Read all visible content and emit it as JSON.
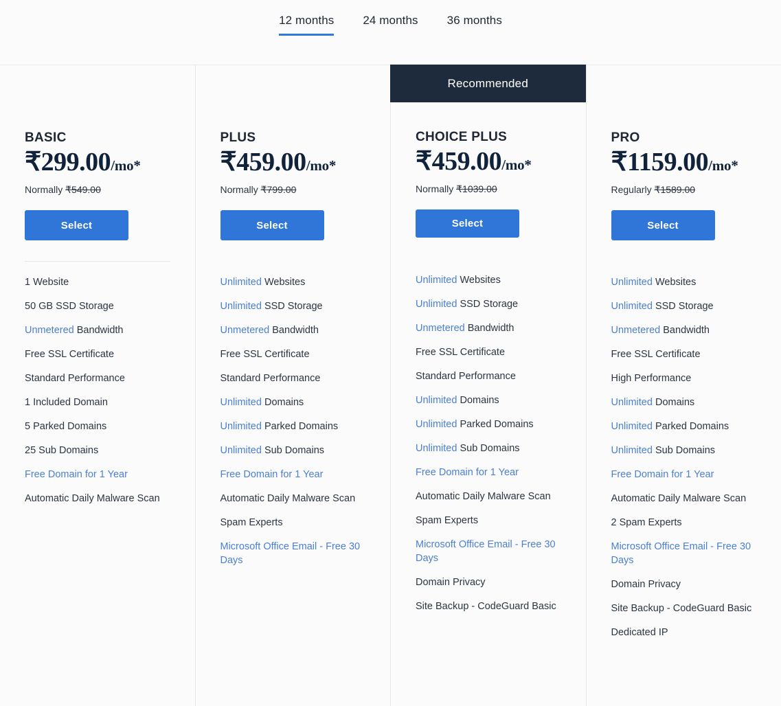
{
  "terms": {
    "tabs": [
      {
        "label": "12 months",
        "active": true
      },
      {
        "label": "24 months",
        "active": false
      },
      {
        "label": "36 months",
        "active": false
      }
    ]
  },
  "colors": {
    "accent_blue": "#2f76d8",
    "link_blue": "#4a7fd4",
    "ribbon_navy": "#1e2b3c",
    "page_bg": "#fbfbfb",
    "text": "#2b3441"
  },
  "ribbon_label": "Recommended",
  "plans": [
    {
      "name": "BASIC",
      "price_amount": "₹299.00",
      "price_period": "/mo*",
      "normally_label": "Normally",
      "normally_price": "₹549.00",
      "select_label": "Select",
      "recommended": false,
      "features": [
        {
          "highlight": "",
          "rest": "1 Website"
        },
        {
          "highlight": "",
          "rest": "50 GB SSD Storage"
        },
        {
          "highlight": "Unmetered",
          "rest": " Bandwidth"
        },
        {
          "highlight": "",
          "rest": "Free SSL Certificate"
        },
        {
          "highlight": "",
          "rest": "Standard Performance"
        },
        {
          "highlight": "",
          "rest": "1 Included Domain"
        },
        {
          "highlight": "",
          "rest": "5 Parked Domains"
        },
        {
          "highlight": "",
          "rest": "25 Sub Domains"
        },
        {
          "highlight": "Free Domain for 1 Year",
          "rest": ""
        },
        {
          "highlight": "",
          "rest": "Automatic Daily Malware Scan"
        }
      ]
    },
    {
      "name": "PLUS",
      "price_amount": "₹459.00",
      "price_period": "/mo*",
      "normally_label": "Normally",
      "normally_price": "₹799.00",
      "select_label": "Select",
      "recommended": false,
      "features": [
        {
          "highlight": "Unlimited",
          "rest": " Websites"
        },
        {
          "highlight": "Unlimited",
          "rest": " SSD Storage"
        },
        {
          "highlight": "Unmetered",
          "rest": " Bandwidth"
        },
        {
          "highlight": "",
          "rest": "Free SSL Certificate"
        },
        {
          "highlight": "",
          "rest": "Standard Performance"
        },
        {
          "highlight": "Unlimited",
          "rest": " Domains"
        },
        {
          "highlight": "Unlimited",
          "rest": " Parked Domains"
        },
        {
          "highlight": "Unlimited",
          "rest": " Sub Domains"
        },
        {
          "highlight": "Free Domain for 1 Year",
          "rest": ""
        },
        {
          "highlight": "",
          "rest": "Automatic Daily Malware Scan"
        },
        {
          "highlight": "",
          "rest": "Spam Experts"
        },
        {
          "highlight": "Microsoft Office Email - Free 30 Days",
          "rest": ""
        }
      ]
    },
    {
      "name": "CHOICE PLUS",
      "price_amount": "₹459.00",
      "price_period": "/mo*",
      "normally_label": "Normally",
      "normally_price": "₹1039.00",
      "select_label": "Select",
      "recommended": true,
      "features": [
        {
          "highlight": "Unlimited",
          "rest": " Websites"
        },
        {
          "highlight": "Unlimited",
          "rest": " SSD Storage"
        },
        {
          "highlight": "Unmetered",
          "rest": " Bandwidth"
        },
        {
          "highlight": "",
          "rest": "Free SSL Certificate"
        },
        {
          "highlight": "",
          "rest": "Standard Performance"
        },
        {
          "highlight": "Unlimited",
          "rest": " Domains"
        },
        {
          "highlight": "Unlimited",
          "rest": " Parked Domains"
        },
        {
          "highlight": "Unlimited",
          "rest": " Sub Domains"
        },
        {
          "highlight": "Free Domain for 1 Year",
          "rest": ""
        },
        {
          "highlight": "",
          "rest": "Automatic Daily Malware Scan"
        },
        {
          "highlight": "",
          "rest": "Spam Experts"
        },
        {
          "highlight": "Microsoft Office Email - Free 30 Days",
          "rest": ""
        },
        {
          "highlight": "",
          "rest": "Domain Privacy"
        },
        {
          "highlight": "",
          "rest": "Site Backup - CodeGuard Basic"
        }
      ]
    },
    {
      "name": "PRO",
      "price_amount": "₹1159.00",
      "price_period": "/mo*",
      "normally_label": "Regularly",
      "normally_price": "₹1589.00",
      "select_label": "Select",
      "recommended": false,
      "features": [
        {
          "highlight": "Unlimited",
          "rest": " Websites"
        },
        {
          "highlight": "Unlimited",
          "rest": " SSD Storage"
        },
        {
          "highlight": "Unmetered",
          "rest": " Bandwidth"
        },
        {
          "highlight": "",
          "rest": "Free SSL Certificate"
        },
        {
          "highlight": "",
          "rest": "High Performance"
        },
        {
          "highlight": "Unlimited",
          "rest": " Domains"
        },
        {
          "highlight": "Unlimited",
          "rest": " Parked Domains"
        },
        {
          "highlight": "Unlimited",
          "rest": " Sub Domains"
        },
        {
          "highlight": "Free Domain for 1 Year",
          "rest": ""
        },
        {
          "highlight": "",
          "rest": "Automatic Daily Malware Scan"
        },
        {
          "highlight": "",
          "rest": "2 Spam Experts"
        },
        {
          "highlight": "Microsoft Office Email - Free 30 Days",
          "rest": ""
        },
        {
          "highlight": "",
          "rest": "Domain Privacy"
        },
        {
          "highlight": "",
          "rest": "Site Backup - CodeGuard Basic"
        },
        {
          "highlight": "",
          "rest": "Dedicated IP"
        }
      ]
    }
  ]
}
